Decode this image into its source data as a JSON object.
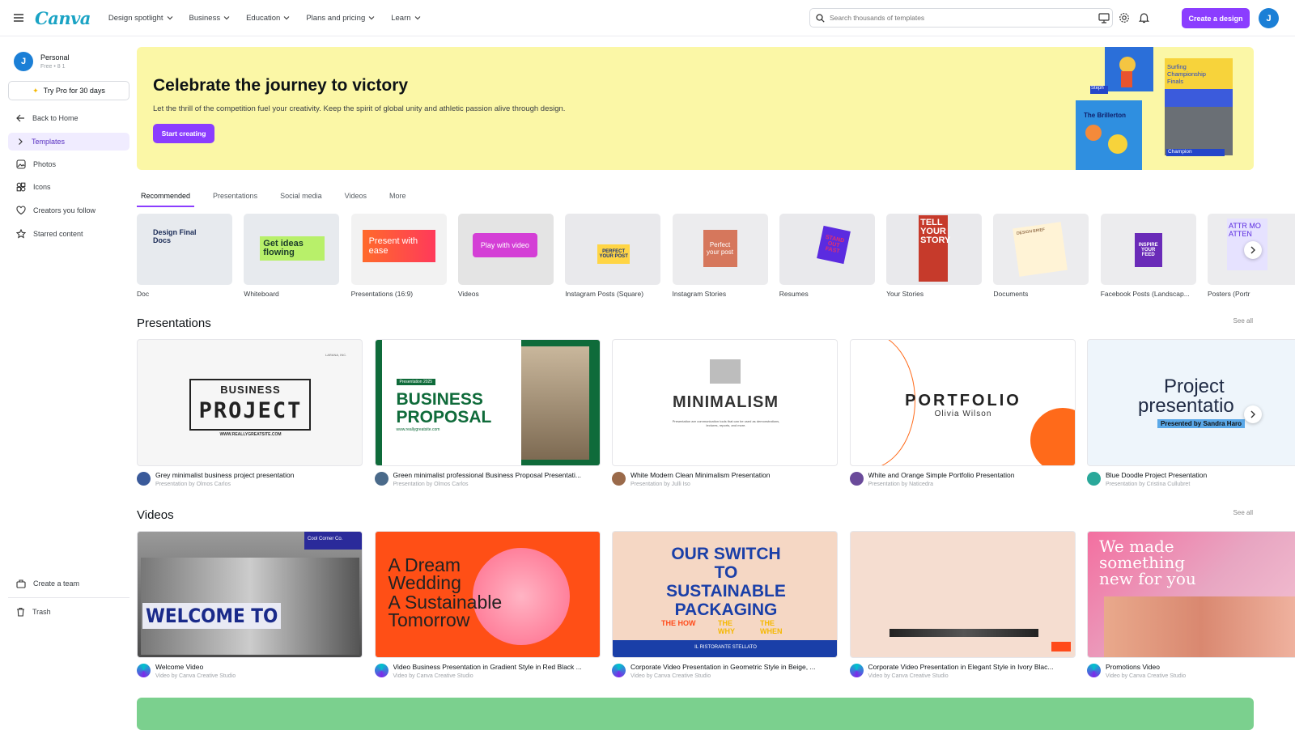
{
  "header": {
    "logo": "Canva",
    "nav": [
      "Design spotlight",
      "Business",
      "Education",
      "Plans and pricing",
      "Learn"
    ],
    "search_placeholder": "Search thousands of templates",
    "create_label": "Create a design",
    "avatar_initial": "J"
  },
  "sidebar": {
    "account_name": "Personal",
    "account_sub": "Free • 8 1",
    "avatar_initial": "J",
    "try_pro": "Try Pro for 30 days",
    "back_home": "Back to Home",
    "items": [
      "Templates",
      "Photos",
      "Icons",
      "Creators you follow",
      "Starred content"
    ],
    "create_team": "Create a team",
    "trash": "Trash"
  },
  "hero": {
    "title": "Celebrate the journey to victory",
    "subtitle": "Let the thrill of the competition fuel your creativity. Keep the spirit of global unity and athletic passion alive through design.",
    "button": "Start creating",
    "art_labels": {
      "steph": "Steph",
      "surfing": "Surfing Championship Finals",
      "brillerton": "The Brillerton",
      "champion": "Champion"
    }
  },
  "tabs": [
    "Recommended",
    "Presentations",
    "Social media",
    "Videos",
    "More"
  ],
  "categories": [
    {
      "label": "Doc",
      "thumb_text": "Design Final Docs"
    },
    {
      "label": "Whiteboard",
      "thumb_text": "Get ideas flowing"
    },
    {
      "label": "Presentations (16:9)",
      "thumb_text": "Present with ease"
    },
    {
      "label": "Videos",
      "thumb_text": "Play with video"
    },
    {
      "label": "Instagram Posts (Square)",
      "thumb_text": "PERFECT YOUR POST"
    },
    {
      "label": "Instagram Stories",
      "thumb_text": "Perfect your post"
    },
    {
      "label": "Resumes",
      "thumb_text": "STAND OUT FAST"
    },
    {
      "label": "Your Stories",
      "thumb_text": "TELL YOUR STORY"
    },
    {
      "label": "Documents",
      "thumb_text": "DESIGN BRIEF"
    },
    {
      "label": "Facebook Posts (Landscap...",
      "thumb_text": "INSPIRE YOUR FEED"
    },
    {
      "label": "Posters (Portr",
      "thumb_text": "ATTR MO ATTEN"
    }
  ],
  "presentations": {
    "title": "Presentations",
    "see_all": "See all",
    "items": [
      {
        "title": "Grey minimalist business project presentation",
        "by": "Presentation by Olmos Carlos",
        "t1": "BUSINESS",
        "t2": "PROJECT",
        "t3": "WWW.REALLYGREATSITE.COM",
        "t4": "LARANA, INC."
      },
      {
        "title": "Green minimalist professional Business Proposal Presentati...",
        "by": "Presentation by Olmos Carlos",
        "t1": "BUSINESS",
        "t2": "PROPOSAL",
        "t3": "www.reallygreatsite.com",
        "t4": "Presentation 2025"
      },
      {
        "title": "White Modern Clean Minimalism Presentation",
        "by": "Presentation by Julli Iso",
        "t1": "MINIMALISM",
        "t2": "Presentation are communication tools that can be used as demonstrations, lectures, reports, and more."
      },
      {
        "title": "White and Orange Simple Portfolio Presentation",
        "by": "Presentation by Naticedra",
        "t1": "PORTFOLIO",
        "t2": "Olivia Wilson"
      },
      {
        "title": "Blue Doodle Project Presentation",
        "by": "Presentation by Cristina Cullubret",
        "t1": "Project",
        "t2": "presentatio",
        "t3": "Presented by Sandra Haro"
      }
    ]
  },
  "videos": {
    "title": "Videos",
    "see_all": "See all",
    "items": [
      {
        "title": "Welcome Video",
        "by": "Video by Canva Creative Studio",
        "t1": "WELCOME TO",
        "t2": "Cool Corner Co."
      },
      {
        "title": "Video Business Presentation in Gradient Style in Red Black ...",
        "by": "Video by Canva Creative Studio",
        "t1": "A Dream Wedding",
        "t2": "A Sustainable Tomorrow"
      },
      {
        "title": "Corporate Video Presentation in Geometric Style in Beige, ...",
        "by": "Video by Canva Creative Studio",
        "t1": "OUR SWITCH TO SUSTAINABLE PACKAGING",
        "t2": "THE HOW",
        "t3": "THE WHY",
        "t4": "THE WHEN",
        "t5": "IL RISTORANTE STELLATO"
      },
      {
        "title": "Corporate Video Presentation in Elegant Style in Ivory Blac...",
        "by": "Video by Canva Creative Studio"
      },
      {
        "title": "Promotions Video",
        "by": "Video by Canva Creative Studio",
        "t1": "We made something new for you"
      }
    ]
  },
  "colors": {
    "accent": "#8b3dff",
    "hero_bg": "#fbf7a6",
    "brand": "#1aa3c4"
  }
}
